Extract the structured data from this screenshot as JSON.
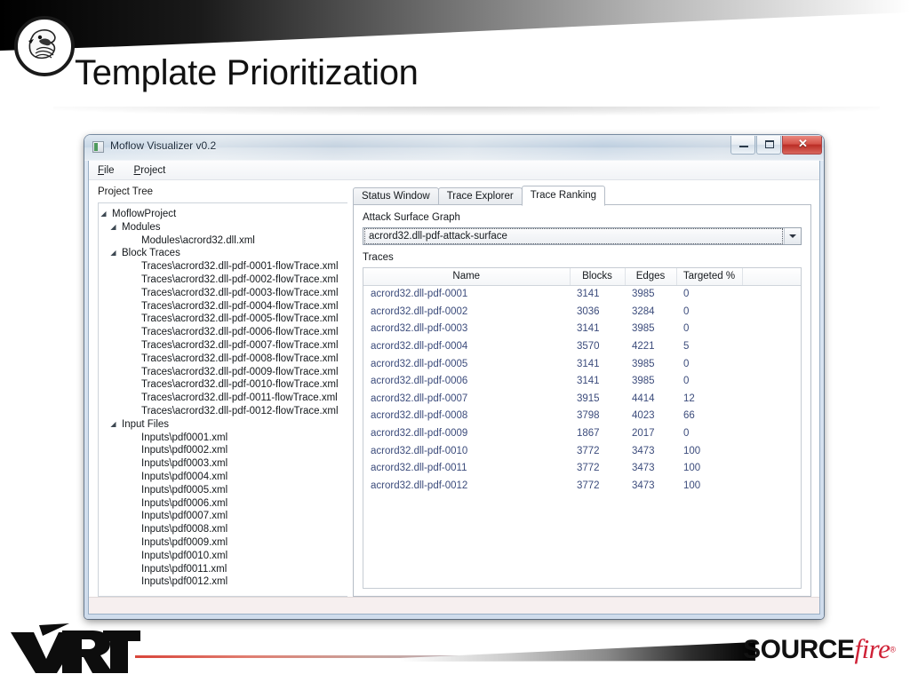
{
  "slide": {
    "title": "Template Prioritization",
    "logo_alt": "vrt-bird-logo"
  },
  "window": {
    "title": "Moflow Visualizer v0.2",
    "controls": {
      "minimize": "–",
      "maximize": "❐",
      "close": "✕"
    },
    "menu": [
      {
        "label": "File",
        "mnemonic": "F"
      },
      {
        "label": "Project",
        "mnemonic": "P"
      }
    ]
  },
  "tree_pane": {
    "label": "Project Tree",
    "nodes": [
      {
        "indent": 0,
        "expander": "◢",
        "label": "MoflowProject"
      },
      {
        "indent": 1,
        "expander": "◢",
        "label": "Modules"
      },
      {
        "indent": 3,
        "expander": "",
        "label": "Modules\\acrord32.dll.xml"
      },
      {
        "indent": 1,
        "expander": "◢",
        "label": "Block Traces"
      },
      {
        "indent": 3,
        "expander": "",
        "label": "Traces\\acrord32.dll-pdf-0001-flowTrace.xml"
      },
      {
        "indent": 3,
        "expander": "",
        "label": "Traces\\acrord32.dll-pdf-0002-flowTrace.xml"
      },
      {
        "indent": 3,
        "expander": "",
        "label": "Traces\\acrord32.dll-pdf-0003-flowTrace.xml"
      },
      {
        "indent": 3,
        "expander": "",
        "label": "Traces\\acrord32.dll-pdf-0004-flowTrace.xml"
      },
      {
        "indent": 3,
        "expander": "",
        "label": "Traces\\acrord32.dll-pdf-0005-flowTrace.xml"
      },
      {
        "indent": 3,
        "expander": "",
        "label": "Traces\\acrord32.dll-pdf-0006-flowTrace.xml"
      },
      {
        "indent": 3,
        "expander": "",
        "label": "Traces\\acrord32.dll-pdf-0007-flowTrace.xml"
      },
      {
        "indent": 3,
        "expander": "",
        "label": "Traces\\acrord32.dll-pdf-0008-flowTrace.xml"
      },
      {
        "indent": 3,
        "expander": "",
        "label": "Traces\\acrord32.dll-pdf-0009-flowTrace.xml"
      },
      {
        "indent": 3,
        "expander": "",
        "label": "Traces\\acrord32.dll-pdf-0010-flowTrace.xml"
      },
      {
        "indent": 3,
        "expander": "",
        "label": "Traces\\acrord32.dll-pdf-0011-flowTrace.xml"
      },
      {
        "indent": 3,
        "expander": "",
        "label": "Traces\\acrord32.dll-pdf-0012-flowTrace.xml"
      },
      {
        "indent": 1,
        "expander": "◢",
        "label": "Input Files"
      },
      {
        "indent": 3,
        "expander": "",
        "label": "Inputs\\pdf0001.xml"
      },
      {
        "indent": 3,
        "expander": "",
        "label": "Inputs\\pdf0002.xml"
      },
      {
        "indent": 3,
        "expander": "",
        "label": "Inputs\\pdf0003.xml"
      },
      {
        "indent": 3,
        "expander": "",
        "label": "Inputs\\pdf0004.xml"
      },
      {
        "indent": 3,
        "expander": "",
        "label": "Inputs\\pdf0005.xml"
      },
      {
        "indent": 3,
        "expander": "",
        "label": "Inputs\\pdf0006.xml"
      },
      {
        "indent": 3,
        "expander": "",
        "label": "Inputs\\pdf0007.xml"
      },
      {
        "indent": 3,
        "expander": "",
        "label": "Inputs\\pdf0008.xml"
      },
      {
        "indent": 3,
        "expander": "",
        "label": "Inputs\\pdf0009.xml"
      },
      {
        "indent": 3,
        "expander": "",
        "label": "Inputs\\pdf0010.xml"
      },
      {
        "indent": 3,
        "expander": "",
        "label": "Inputs\\pdf0011.xml"
      },
      {
        "indent": 3,
        "expander": "",
        "label": "Inputs\\pdf0012.xml"
      }
    ]
  },
  "tabs": [
    {
      "label": "Status Window",
      "active": false
    },
    {
      "label": "Trace Explorer",
      "active": false
    },
    {
      "label": "Trace Ranking",
      "active": true
    }
  ],
  "trace_ranking": {
    "graph_label": "Attack Surface Graph",
    "graph_selected": "acrord32.dll-pdf-attack-surface",
    "traces_label": "Traces",
    "columns": [
      "Name",
      "Blocks",
      "Edges",
      "Targeted %",
      ""
    ],
    "rows": [
      {
        "name": "acrord32.dll-pdf-0001",
        "blocks": "3141",
        "edges": "3985",
        "targeted": "0"
      },
      {
        "name": "acrord32.dll-pdf-0002",
        "blocks": "3036",
        "edges": "3284",
        "targeted": "0"
      },
      {
        "name": "acrord32.dll-pdf-0003",
        "blocks": "3141",
        "edges": "3985",
        "targeted": "0"
      },
      {
        "name": "acrord32.dll-pdf-0004",
        "blocks": "3570",
        "edges": "4221",
        "targeted": "5"
      },
      {
        "name": "acrord32.dll-pdf-0005",
        "blocks": "3141",
        "edges": "3985",
        "targeted": "0"
      },
      {
        "name": "acrord32.dll-pdf-0006",
        "blocks": "3141",
        "edges": "3985",
        "targeted": "0"
      },
      {
        "name": "acrord32.dll-pdf-0007",
        "blocks": "3915",
        "edges": "4414",
        "targeted": "12"
      },
      {
        "name": "acrord32.dll-pdf-0008",
        "blocks": "3798",
        "edges": "4023",
        "targeted": "66"
      },
      {
        "name": "acrord32.dll-pdf-0009",
        "blocks": "1867",
        "edges": "2017",
        "targeted": "0"
      },
      {
        "name": "acrord32.dll-pdf-0010",
        "blocks": "3772",
        "edges": "3473",
        "targeted": "100"
      },
      {
        "name": "acrord32.dll-pdf-0011",
        "blocks": "3772",
        "edges": "3473",
        "targeted": "100"
      },
      {
        "name": "acrord32.dll-pdf-0012",
        "blocks": "3772",
        "edges": "3473",
        "targeted": "100"
      }
    ]
  },
  "footer": {
    "vrt_text": "VRT",
    "sourcefire_black": "SOURCE",
    "sourcefire_red": "fire",
    "sourcefire_reg": "®"
  },
  "colors": {
    "link_blue": "#3c4c7c",
    "brand_red": "#cf2136",
    "close_red": "#c3372e",
    "accent_line": "#d9453a"
  }
}
